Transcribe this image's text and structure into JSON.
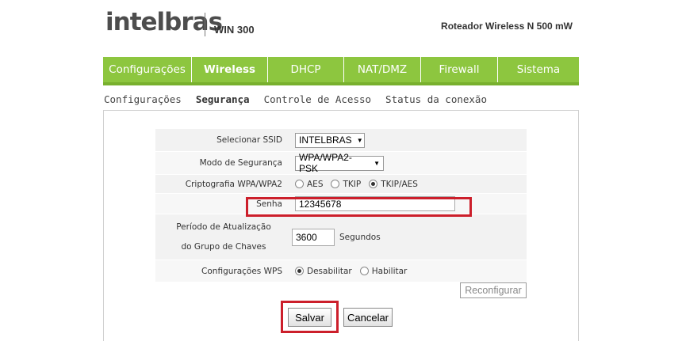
{
  "header": {
    "brand": "intelbras",
    "model": "WIN 300",
    "device_description": "Roteador Wireless N 500 mW"
  },
  "main_nav": [
    {
      "label": "Configurações",
      "active": false
    },
    {
      "label": "Wireless",
      "active": true
    },
    {
      "label": "DHCP",
      "active": false
    },
    {
      "label": "NAT/DMZ",
      "active": false
    },
    {
      "label": "Firewall",
      "active": false
    },
    {
      "label": "Sistema",
      "active": false
    }
  ],
  "sub_nav": [
    {
      "label": "Configurações",
      "active": false
    },
    {
      "label": "Segurança",
      "active": true
    },
    {
      "label": "Controle de Acesso",
      "active": false
    },
    {
      "label": "Status da conexão",
      "active": false
    }
  ],
  "form": {
    "ssid_label": "Selecionar SSID",
    "ssid_value": "INTELBRAS",
    "security_mode_label": "Modo de Segurança",
    "security_mode_value": "WPA/WPA2-PSK",
    "crypto_label": "Criptografia WPA/WPA2",
    "crypto_options": [
      "AES",
      "TKIP",
      "TKIP/AES"
    ],
    "crypto_selected": "TKIP/AES",
    "password_label": "Senha",
    "password_value": "12345678",
    "rekey_label_line1": "Período de Atualização",
    "rekey_label_line2": "do Grupo de Chaves",
    "rekey_value": "3600",
    "rekey_unit": "Segundos",
    "wps_label": "Configurações WPS",
    "wps_options": [
      "Desabilitar",
      "Habilitar"
    ],
    "wps_selected": "Desabilitar"
  },
  "buttons": {
    "reconfigure": "Reconfigurar",
    "save": "Salvar",
    "cancel": "Cancelar"
  },
  "colors": {
    "nav_green": "#8dc63f",
    "highlight_red": "#cc1f2b"
  }
}
